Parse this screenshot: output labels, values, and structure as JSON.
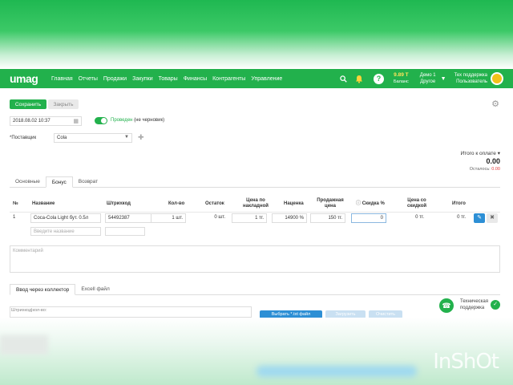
{
  "nav": {
    "logo": "umag",
    "items": [
      "Главная",
      "Отчеты",
      "Продажи",
      "Закупки",
      "Товары",
      "Финансы",
      "Контрагенты",
      "Управление"
    ],
    "balance_value": "9.89 Т",
    "balance_label": "Баланс",
    "demo_line1": "Демо 1",
    "demo_line2": "Другое",
    "support_line1": "Тех поддержка",
    "support_line2": "Пользователь",
    "help_symbol": "?"
  },
  "toolbar": {
    "save": "Сохранить",
    "close": "Закрыть"
  },
  "form": {
    "date": "2018.08.02 10:37",
    "posted_status": "Проведен",
    "posted_note": "(не черновик)",
    "supplier_label": "*Поставщик",
    "supplier_value": "Cola"
  },
  "totals": {
    "label": "Итого к оплате",
    "value": "0.00",
    "remaining_label": "Осталось:",
    "remaining_value": "0.00"
  },
  "tabs": [
    "Основные",
    "Бонус",
    "Возврат"
  ],
  "active_tab": "Бонус",
  "table": {
    "headers": {
      "num": "№",
      "name": "Название",
      "barcode": "Штрихкод",
      "qty": "Кол-во",
      "stock": "Остаток",
      "invoice_price": "Цена по накладной",
      "markup": "Наценка",
      "sale_price": "Продажная цена",
      "discount": "Скидка %",
      "discounted_price": "Цена со скидкой",
      "total": "Итого"
    },
    "rows": [
      {
        "num": "1",
        "name": "Coca-Cola Light бут. 0.5л",
        "barcode": "54492387",
        "qty": "1 шт.",
        "stock": "0 шт.",
        "invoice_price": "1 тг.",
        "markup": "14900 %",
        "sale_price": "150 тг.",
        "discount": "0",
        "discounted_price": "0 тг.",
        "total": "0 тг."
      }
    ],
    "new_name_placeholder": "Введите название"
  },
  "comment_placeholder": "Комментарий",
  "input_tabs": [
    "Ввод через коллектор",
    "Excell файл"
  ],
  "collector": {
    "barcode_label": "Штрихкод|кол-во:",
    "upload_button": "Выбрать *.txt файл",
    "button2": "Загрузить",
    "button3": "Очистить"
  },
  "support_widget": {
    "line1": "Техническая",
    "line2": "поддержка"
  },
  "watermark": "InShOt",
  "colors": {
    "brand_green": "#22b14c",
    "action_blue": "#2d8fd5",
    "danger_red": "#e23b3b"
  }
}
